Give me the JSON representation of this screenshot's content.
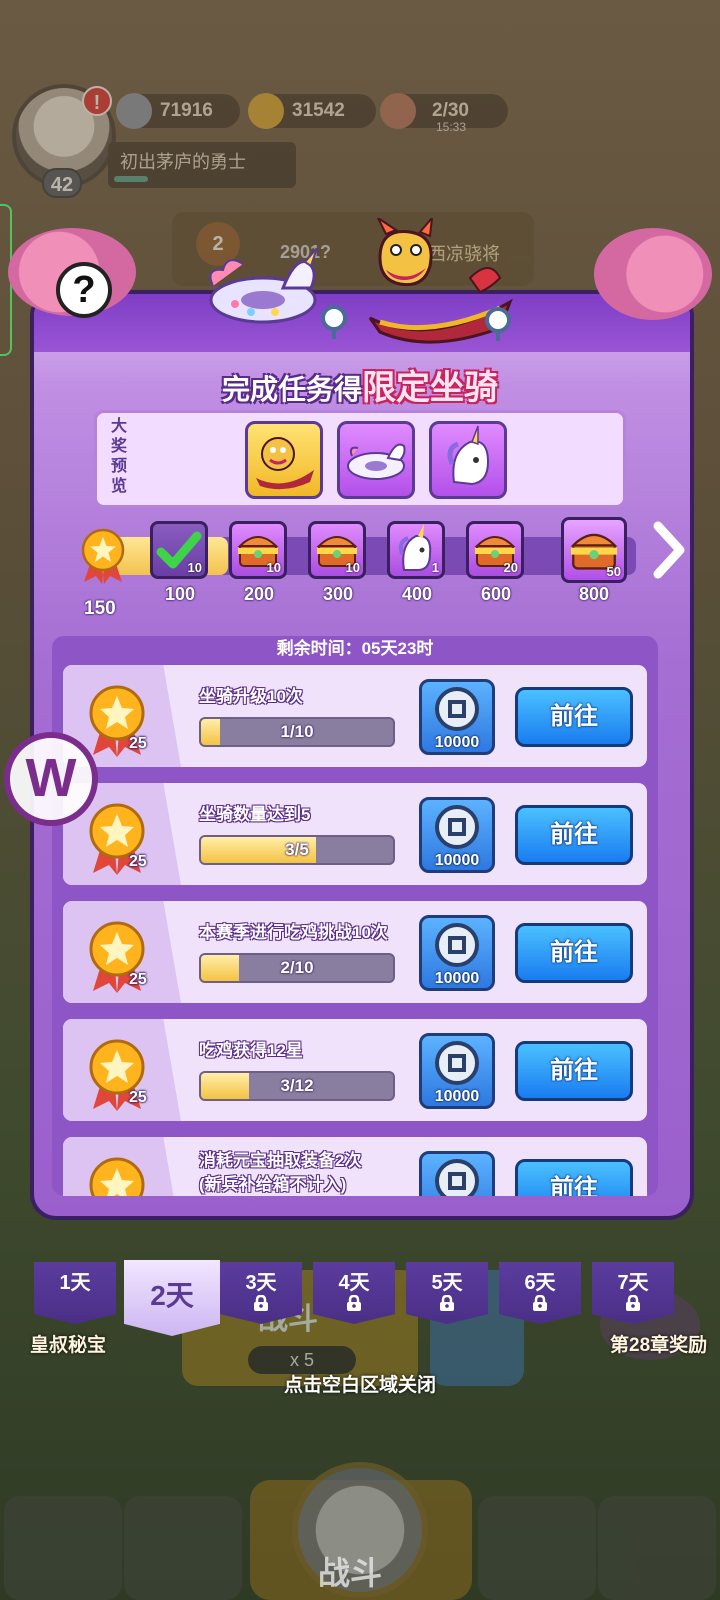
{
  "player": {
    "level": "42",
    "title": "初出茅庐的勇士",
    "alert": "!"
  },
  "resources": {
    "silver": "71916",
    "gold": "31542",
    "stamina": "2/30",
    "stamina_timer": "15:33"
  },
  "background": {
    "rank_number": "2",
    "rank_score": "2901?",
    "rank_title": "西凉骁将",
    "battle_label": "战斗",
    "ticket_count": "x 5",
    "left_feature": "皇叔秘宝",
    "right_feature": "第28章奖励",
    "bottom_battle": "战斗"
  },
  "modal": {
    "help": "?",
    "title_part1": "完成任务得",
    "title_part2": "限定坐骑",
    "preview_label": "大奖预览",
    "progress": {
      "current_points": "150",
      "milestones": [
        {
          "value": "100",
          "count": "10",
          "reward": "claimed-check",
          "claimed": true
        },
        {
          "value": "200",
          "count": "10",
          "reward": "treasure-chest"
        },
        {
          "value": "300",
          "count": "10",
          "reward": "treasure-chest"
        },
        {
          "value": "400",
          "count": "1",
          "reward": "unicorn-mount"
        },
        {
          "value": "600",
          "count": "20",
          "reward": "treasure-chest"
        },
        {
          "value": "800",
          "count": "50",
          "reward": "treasure-chest"
        }
      ]
    },
    "timer": "剩余时间：05天23时",
    "tasks": [
      {
        "name": "坐骑升级10次",
        "progress": "1/10",
        "fraction": 0.1,
        "medal": "25",
        "coins": "10000",
        "button": "前往"
      },
      {
        "name": "坐骑数量达到5",
        "progress": "3/5",
        "fraction": 0.6,
        "medal": "25",
        "coins": "10000",
        "button": "前往"
      },
      {
        "name": "本赛季进行吃鸡挑战10次",
        "progress": "2/10",
        "fraction": 0.2,
        "medal": "25",
        "coins": "10000",
        "button": "前往"
      },
      {
        "name": "吃鸡获得12星",
        "progress": "3/12",
        "fraction": 0.25,
        "medal": "25",
        "coins": "10000",
        "button": "前往"
      },
      {
        "name": "消耗元宝抽取装备2次",
        "name2": "(新兵补给箱不计入)",
        "progress": "",
        "fraction": 0.0,
        "medal": "25",
        "coins": "10000",
        "button": "前往"
      }
    ],
    "day_tabs": [
      {
        "label": "1天",
        "locked": false
      },
      {
        "label": "2天",
        "locked": false,
        "active": true
      },
      {
        "label": "3天",
        "locked": true
      },
      {
        "label": "4天",
        "locked": true
      },
      {
        "label": "5天",
        "locked": true
      },
      {
        "label": "6天",
        "locked": true
      },
      {
        "label": "7天",
        "locked": true
      }
    ],
    "close_hint": "点击空白区域关闭"
  },
  "colors": {
    "modal_purple": "#a56ed3",
    "gold": "#f3c24d",
    "go_button_blue": "#1a7cf0",
    "alert_red": "#e22a2a"
  }
}
